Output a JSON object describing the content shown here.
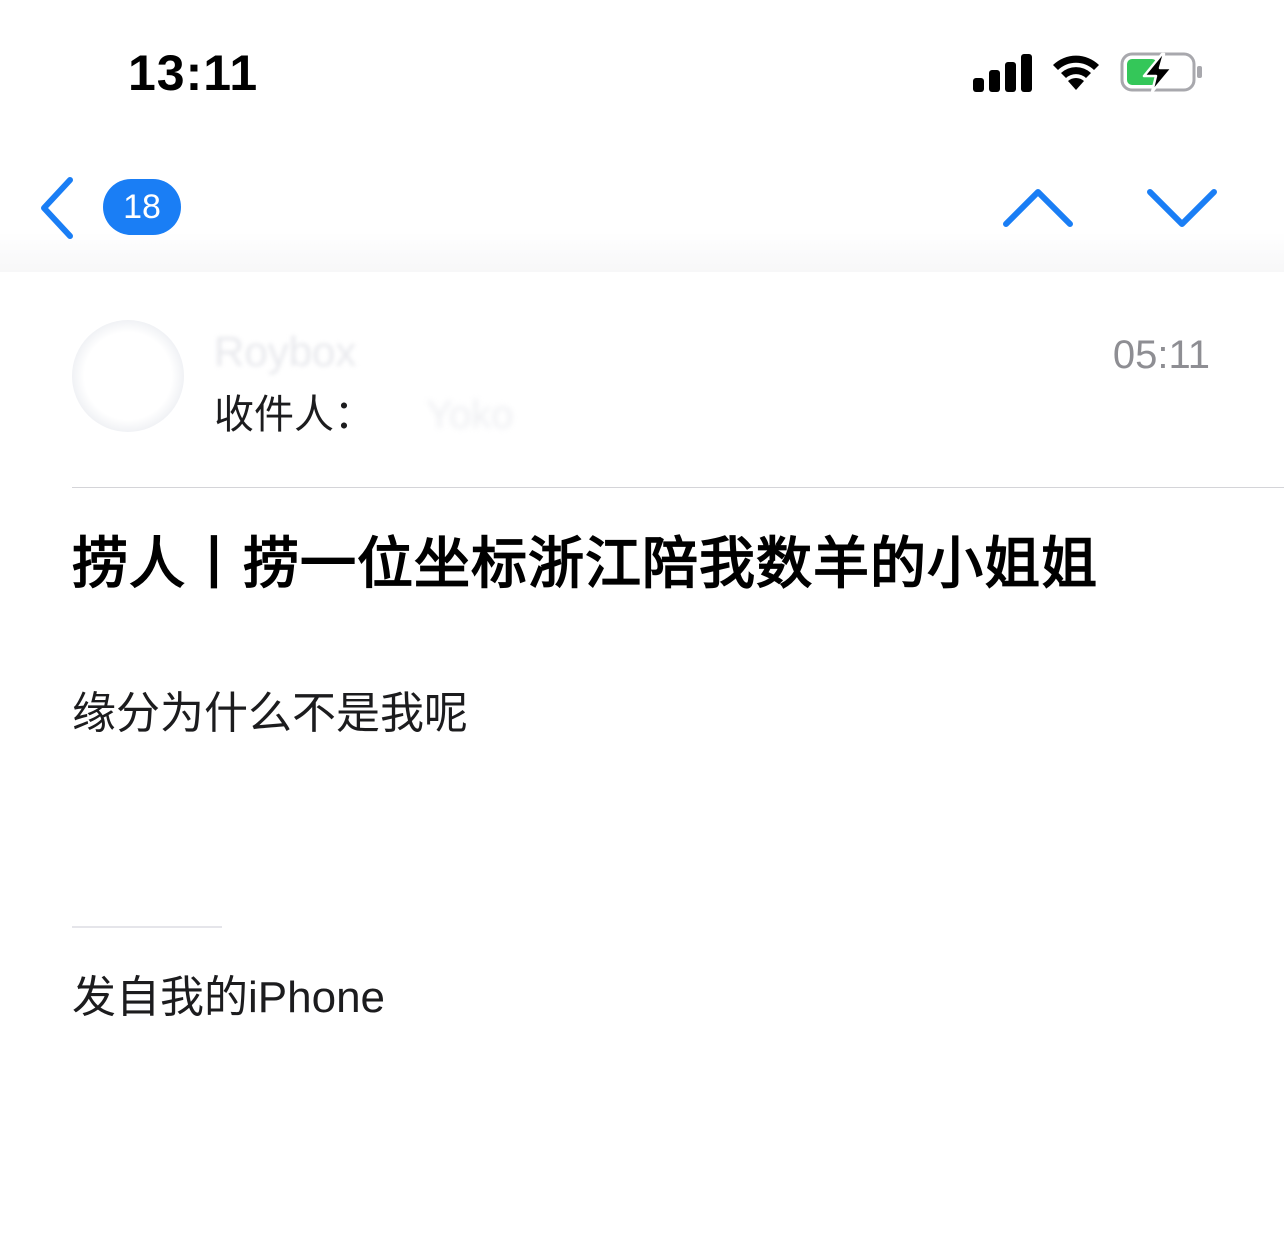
{
  "status_bar": {
    "time": "13:11",
    "icons": [
      "cellular-signal-icon",
      "wifi-icon",
      "battery-charging-icon"
    ],
    "battery_color": "#34c759"
  },
  "nav": {
    "back_icon": "chevron-left-icon",
    "unread_count": "18",
    "previous_icon": "chevron-up-icon",
    "next_icon": "chevron-down-icon",
    "accent_color": "#1a7ef5"
  },
  "message": {
    "sender": "Roybox",
    "recipient_label": "收件人：",
    "recipient": "Yoko",
    "time": "05:11",
    "subject": "捞人丨捞一位坐标浙江陪我数羊的小姐姐",
    "body": "缘分为什么不是我呢",
    "signature": "发自我的iPhone"
  }
}
